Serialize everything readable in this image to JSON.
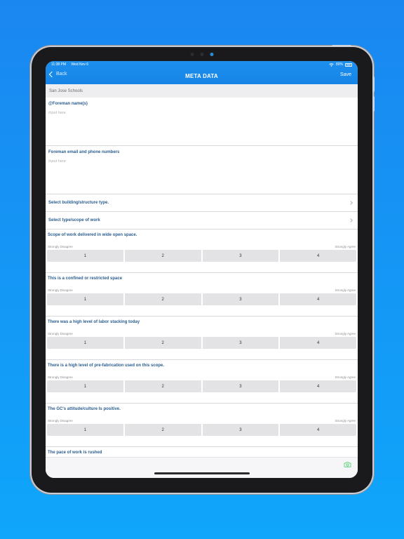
{
  "status_bar": {
    "time": "11:38 PM",
    "date": "Wed Nov 6",
    "battery": "80%"
  },
  "nav": {
    "back_label": "Back",
    "title": "META DATA",
    "save_label": "Save"
  },
  "section_header": "San Jose Schools",
  "fields": [
    {
      "label": "@Foreman name(s)",
      "placeholder": "Input here",
      "value": ""
    },
    {
      "label": "Foreman email and phone numbers",
      "placeholder": "Input here",
      "value": ""
    }
  ],
  "selects": [
    {
      "label": "Select building/structure type."
    },
    {
      "label": "Select type/scope of work"
    }
  ],
  "scale": {
    "min_label": "Strongly Disagree",
    "max_label": "Strongly Agree",
    "options": [
      "1",
      "2",
      "3",
      "4"
    ]
  },
  "questions": [
    {
      "label": "Scope of work delivered in wide open space."
    },
    {
      "label": "This is a confined or restricted space"
    },
    {
      "label": "There was a high level of labor stacking today"
    },
    {
      "label": "There is a high level of pre-fabrication used on this scope."
    },
    {
      "label": "The GC's attitude/culture Is positive."
    }
  ],
  "partial_question": {
    "label": "The pace of work is rushed"
  },
  "colors": {
    "header_blue": "#1584e6",
    "label_blue": "#2b5d8f",
    "accent_green": "#34c759",
    "background": "#1a87f0"
  },
  "icons": {
    "toolbar": "camera-icon"
  }
}
